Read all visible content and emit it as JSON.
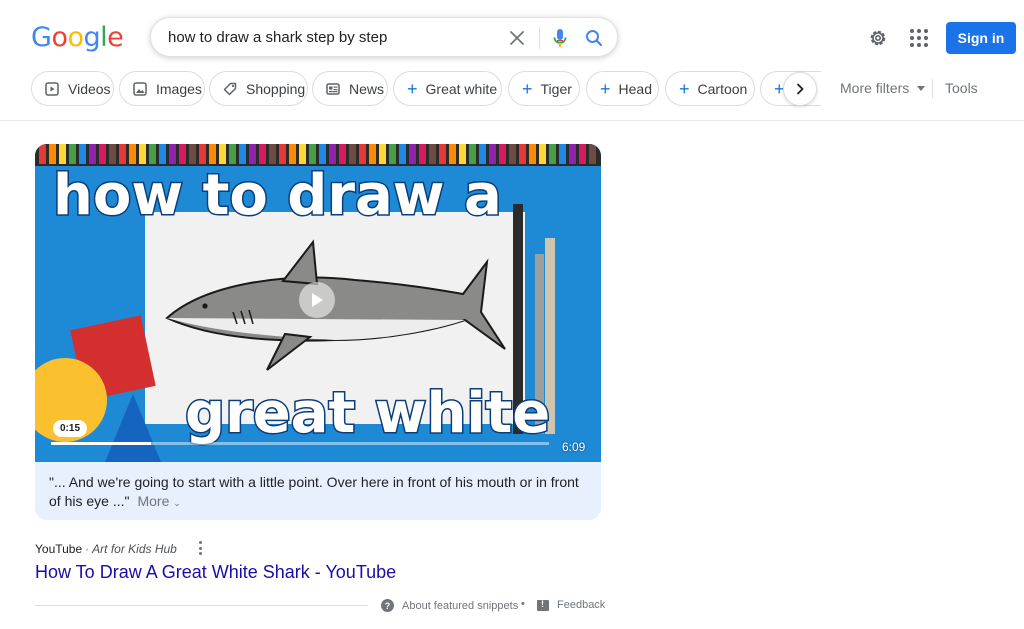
{
  "header": {
    "logo_letters": [
      {
        "char": "G",
        "color": "#4285F4"
      },
      {
        "char": "o",
        "color": "#EA4335"
      },
      {
        "char": "o",
        "color": "#FBBC05"
      },
      {
        "char": "g",
        "color": "#4285F4"
      },
      {
        "char": "l",
        "color": "#34A853"
      },
      {
        "char": "e",
        "color": "#EA4335"
      }
    ],
    "search_query": "how to draw a shark step by step",
    "sign_in_label": "Sign in",
    "icons": [
      "close-icon",
      "mic-icon",
      "search-icon",
      "gear-icon",
      "apps-grid-icon"
    ]
  },
  "chips": [
    {
      "label": "Videos",
      "icon": "video-icon"
    },
    {
      "label": "Images",
      "icon": "image-icon"
    },
    {
      "label": "Shopping",
      "icon": "tag-icon"
    },
    {
      "label": "News",
      "icon": "news-icon"
    },
    {
      "label": "Great white",
      "icon": "plus-icon"
    },
    {
      "label": "Tiger",
      "icon": "plus-icon"
    },
    {
      "label": "Head",
      "icon": "plus-icon"
    },
    {
      "label": "Cartoon",
      "icon": "plus-icon"
    },
    {
      "label": "",
      "icon": "plus-icon"
    }
  ],
  "filters": {
    "more_filters_label": "More filters",
    "tools_label": "Tools"
  },
  "video": {
    "thumbnail_text_top": "how to draw a",
    "thumbnail_text_bottom": "great white",
    "current_time": "0:15",
    "duration": "6:09",
    "progress_fraction": 0.2,
    "snippet": "\"... And we're going to start with a little point. Over here in front of his mouth or in front of his eye ...\"",
    "more_label": "More"
  },
  "result": {
    "source_site": "YouTube",
    "source_sep": "·",
    "source_author": "Art for Kids Hub",
    "title": "How To Draw A Great White Shark - YouTube"
  },
  "footer": {
    "about_label": "About featured snippets",
    "bullet": "•",
    "feedback_label": "Feedback"
  },
  "colors": {
    "accent_blue": "#1a73e8",
    "link_blue": "#1a0dab",
    "card_bg": "#e8f0fe"
  }
}
